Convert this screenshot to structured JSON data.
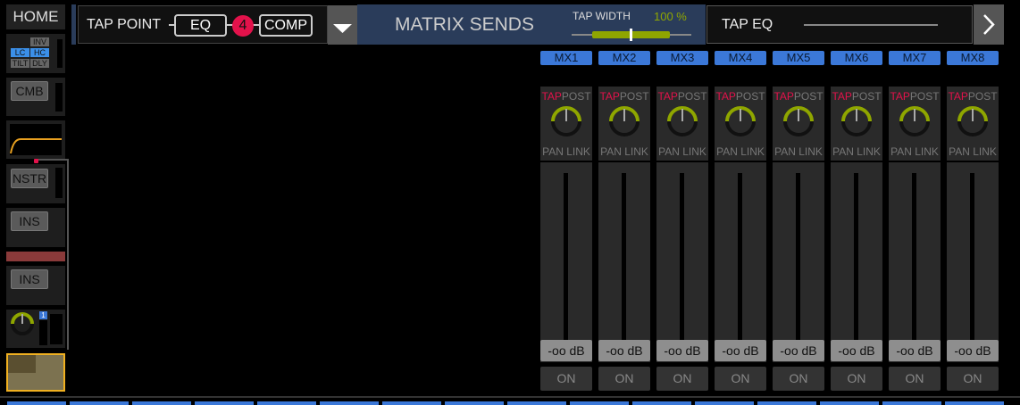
{
  "nav": {
    "home_label": "HOME"
  },
  "sidebar": {
    "inv": "INV",
    "lc": "LC",
    "hc": "HC",
    "tilt": "TILT",
    "dly": "DLY",
    "cmb": "CMB",
    "nstr": "NSTR",
    "ins1": "INS",
    "ins2": "INS",
    "badge": "1"
  },
  "tap_point": {
    "label": "TAP POINT",
    "eq": "EQ",
    "step": "4",
    "comp": "COMP"
  },
  "header": {
    "title": "MATRIX SENDS",
    "tap_width_label": "TAP WIDTH",
    "tap_width_value": "100 %",
    "tap_width_percent": 100
  },
  "tap_eq": {
    "label": "TAP EQ"
  },
  "colors": {
    "accent": "#3b78d8",
    "tap": "#e3124b",
    "knob": "#8fa600"
  },
  "channels": [
    {
      "name": "MX1",
      "tap": "TAP",
      "post": "POST",
      "pan": "PAN LINK",
      "level": "-oo dB",
      "on": "ON"
    },
    {
      "name": "MX2",
      "tap": "TAP",
      "post": "POST",
      "pan": "PAN LINK",
      "level": "-oo dB",
      "on": "ON"
    },
    {
      "name": "MX3",
      "tap": "TAP",
      "post": "POST",
      "pan": "PAN LINK",
      "level": "-oo dB",
      "on": "ON"
    },
    {
      "name": "MX4",
      "tap": "TAP",
      "post": "POST",
      "pan": "PAN LINK",
      "level": "-oo dB",
      "on": "ON"
    },
    {
      "name": "MX5",
      "tap": "TAP",
      "post": "POST",
      "pan": "PAN LINK",
      "level": "-oo dB",
      "on": "ON"
    },
    {
      "name": "MX6",
      "tap": "TAP",
      "post": "POST",
      "pan": "PAN LINK",
      "level": "-oo dB",
      "on": "ON"
    },
    {
      "name": "MX7",
      "tap": "TAP",
      "post": "POST",
      "pan": "PAN LINK",
      "level": "-oo dB",
      "on": "ON"
    },
    {
      "name": "MX8",
      "tap": "TAP",
      "post": "POST",
      "pan": "PAN LINK",
      "level": "-oo dB",
      "on": "ON"
    }
  ]
}
